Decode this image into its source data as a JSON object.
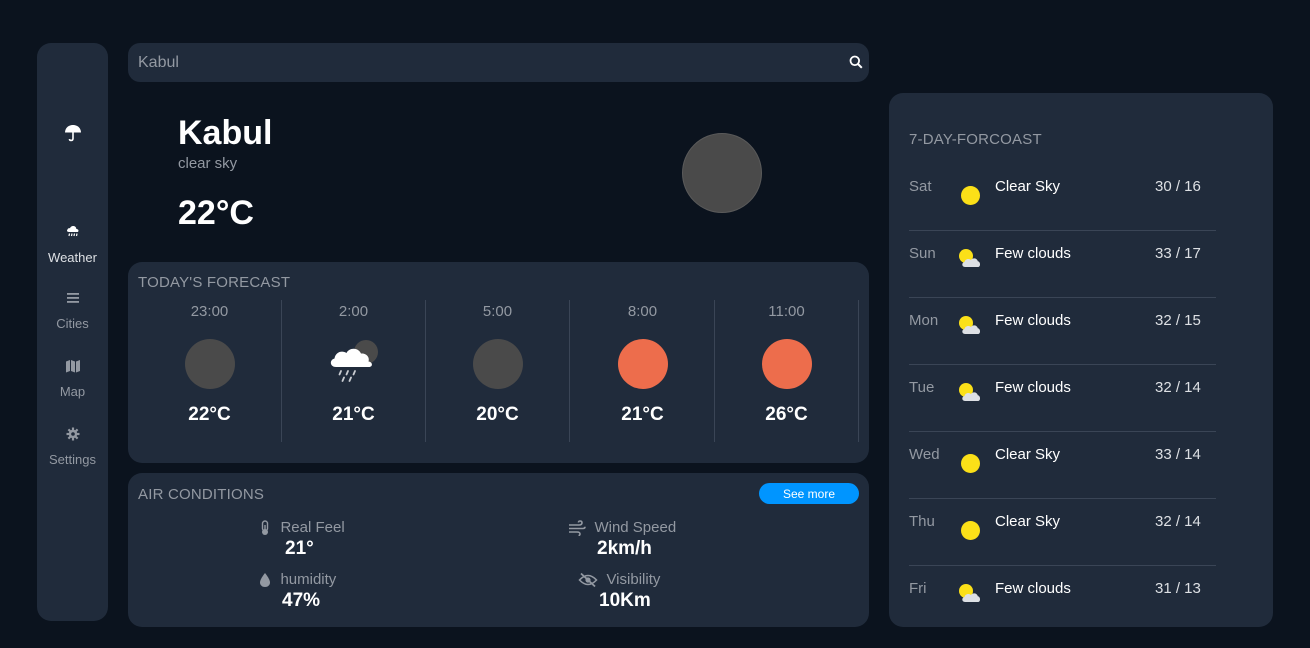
{
  "sidebar": {
    "logo_icon": "umbrella-icon",
    "items": [
      {
        "label": "Weather",
        "icon": "cloud-rain-icon",
        "active": true
      },
      {
        "label": "Cities",
        "icon": "list-icon",
        "active": false
      },
      {
        "label": "Map",
        "icon": "map-icon",
        "active": false
      },
      {
        "label": "Settings",
        "icon": "gear-icon",
        "active": false
      }
    ]
  },
  "search": {
    "value": "Kabul",
    "icon": "search-icon"
  },
  "current": {
    "city": "Kabul",
    "description": "clear sky",
    "temperature": "22°C"
  },
  "today": {
    "title": "TODAY'S FORECAST",
    "hours": [
      {
        "time": "23:00",
        "temp": "22°C",
        "icon": "moon-icon",
        "color": "#4a4a4a"
      },
      {
        "time": "2:00",
        "temp": "21°C",
        "icon": "cloud-rain-moon-icon",
        "color": "#ffffff"
      },
      {
        "time": "5:00",
        "temp": "20°C",
        "icon": "moon-icon",
        "color": "#4a4a4a"
      },
      {
        "time": "8:00",
        "temp": "21°C",
        "icon": "sun-icon",
        "color": "#ed6d4c"
      },
      {
        "time": "11:00",
        "temp": "26°C",
        "icon": "sun-icon",
        "color": "#ed6d4c"
      }
    ]
  },
  "air": {
    "title": "AIR CONDITIONS",
    "see_more": "See more",
    "items": [
      {
        "name": "Real Feel",
        "value": "21°",
        "icon": "thermometer-icon"
      },
      {
        "name": "Wind Speed",
        "value": "2km/h",
        "icon": "wind-icon"
      },
      {
        "name": "humidity",
        "value": "47%",
        "icon": "droplet-icon"
      },
      {
        "name": "Visibility",
        "value": "10Km",
        "icon": "eye-slash-icon"
      }
    ]
  },
  "week": {
    "title": "7-DAY-FORCOAST",
    "days": [
      {
        "day": "Sat",
        "condition": "Clear Sky",
        "range": "30 / 16",
        "icon": "sun-icon"
      },
      {
        "day": "Sun",
        "condition": "Few clouds",
        "range": "33 / 17",
        "icon": "sun-cloud-icon"
      },
      {
        "day": "Mon",
        "condition": "Few clouds",
        "range": "32 / 15",
        "icon": "sun-cloud-icon"
      },
      {
        "day": "Tue",
        "condition": "Few clouds",
        "range": "32 / 14",
        "icon": "sun-cloud-icon"
      },
      {
        "day": "Wed",
        "condition": "Clear Sky",
        "range": "33 / 14",
        "icon": "sun-icon"
      },
      {
        "day": "Thu",
        "condition": "Clear Sky",
        "range": "32 / 14",
        "icon": "sun-icon"
      },
      {
        "day": "Fri",
        "condition": "Few clouds",
        "range": "31 / 13",
        "icon": "sun-cloud-icon"
      }
    ]
  },
  "colors": {
    "background": "#0b131e",
    "panel": "#202b3b",
    "accent": "#0095ff",
    "sun": "#fbe018",
    "orange": "#ed6d4c"
  }
}
